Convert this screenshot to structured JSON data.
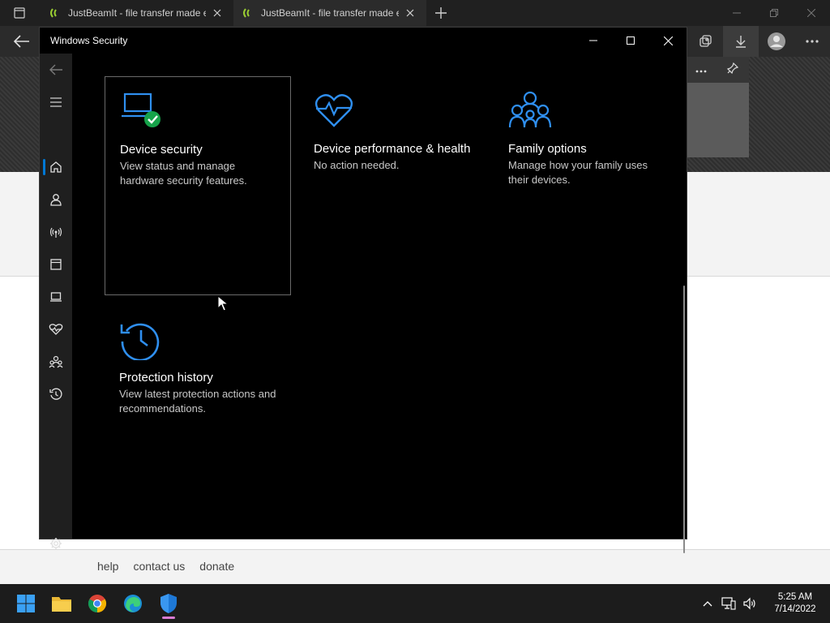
{
  "browser": {
    "tabs": [
      {
        "label": "JustBeamIt - file transfer made e",
        "active": false
      },
      {
        "label": "JustBeamIt - file transfer made e",
        "active": true
      }
    ],
    "footer_links": [
      "help",
      "contact us",
      "donate"
    ]
  },
  "window": {
    "title": "Windows Security"
  },
  "tiles": [
    {
      "title": "Device security",
      "description": "View status and manage hardware security features."
    },
    {
      "title": "Device performance & health",
      "description": "No action needed."
    },
    {
      "title": "Family options",
      "description": "Manage how your family uses their devices."
    },
    {
      "title": "Protection history",
      "description": "View latest protection actions and recommendations."
    }
  ],
  "taskbar": {
    "time": "5:25 AM",
    "date": "7/14/2022"
  },
  "colors": {
    "accent": "#0078d4",
    "ok_green": "#16a34a",
    "favicon_green": "#9acd32"
  }
}
